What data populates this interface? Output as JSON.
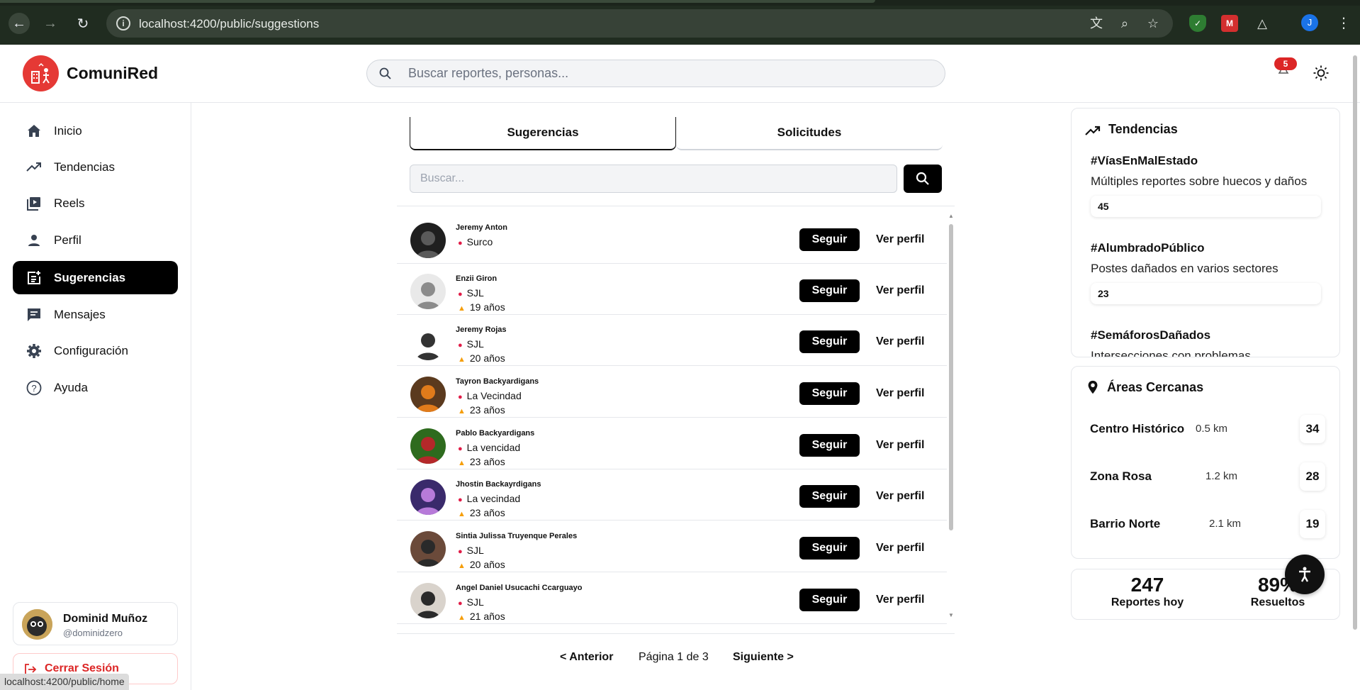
{
  "browser": {
    "url": "localhost:4200/public/suggestions",
    "profile_initial": "J",
    "status_url": "localhost:4200/public/home"
  },
  "app": {
    "brand": "ComuniRed",
    "search_placeholder": "Buscar reportes, personas...",
    "notification_count": "5"
  },
  "sidebar": {
    "items": [
      {
        "label": "Inicio",
        "icon": "home-icon"
      },
      {
        "label": "Tendencias",
        "icon": "trending-icon"
      },
      {
        "label": "Reels",
        "icon": "video-library-icon"
      },
      {
        "label": "Perfil",
        "icon": "person-icon"
      },
      {
        "label": "Sugerencias",
        "icon": "post-add-icon",
        "active": true
      },
      {
        "label": "Mensajes",
        "icon": "chat-icon"
      },
      {
        "label": "Configuración",
        "icon": "gear-icon"
      },
      {
        "label": "Ayuda",
        "icon": "help-icon"
      }
    ],
    "user": {
      "name": "Dominid Muñoz",
      "handle": "@dominidzero"
    },
    "logout_label": "Cerrar Sesión"
  },
  "main": {
    "tabs": [
      {
        "label": "Sugerencias"
      },
      {
        "label": "Solicitudes"
      }
    ],
    "search_placeholder": "Buscar...",
    "follow_label": "Seguir",
    "profile_label": "Ver perfil",
    "users": [
      {
        "name": "Jeremy Anton",
        "location": "Surco",
        "age": ""
      },
      {
        "name": "Enzii Giron",
        "location": "SJL",
        "age": "19 años"
      },
      {
        "name": "Jeremy Rojas",
        "location": "SJL",
        "age": "20 años"
      },
      {
        "name": "Tayron Backyardigans",
        "location": "La Vecindad",
        "age": "23 años"
      },
      {
        "name": "Pablo Backyardigans",
        "location": "La vencidad",
        "age": "23 años"
      },
      {
        "name": "Jhostin Backayrdigans",
        "location": "La vecindad",
        "age": "23 años"
      },
      {
        "name": "Sintia Julissa Truyenque Perales",
        "location": "SJL",
        "age": "20 años"
      },
      {
        "name": "Angel Daniel Usucachi Ccarguayo",
        "location": "SJL",
        "age": "21 años"
      }
    ],
    "pager": {
      "prev": "< Anterior",
      "info": "Página 1 de 3",
      "next": "Siguiente >"
    }
  },
  "right": {
    "trends_title": "Tendencias",
    "trends": [
      {
        "tag": "#VíasEnMalEstado",
        "desc": "Múltiples reportes sobre huecos y daños",
        "count": "45"
      },
      {
        "tag": "#AlumbradoPúblico",
        "desc": "Postes dañados en varios sectores",
        "count": "23"
      },
      {
        "tag": "#SemáforosDañados",
        "desc": "Intersecciones con problemas",
        "count": ""
      }
    ],
    "areas_title": "Áreas Cercanas",
    "areas": [
      {
        "name": "Centro Histórico",
        "distance": "0.5 km",
        "count": "34"
      },
      {
        "name": "Zona Rosa",
        "distance": "1.2 km",
        "count": "28"
      },
      {
        "name": "Barrio Norte",
        "distance": "2.1 km",
        "count": "19"
      }
    ],
    "stats": [
      {
        "value": "247",
        "label": "Reportes hoy"
      },
      {
        "value": "89%",
        "label": "Resueltos"
      }
    ]
  },
  "colors": {
    "accent": "#000000",
    "brand_red": "#e53935",
    "danger": "#dc2626"
  }
}
